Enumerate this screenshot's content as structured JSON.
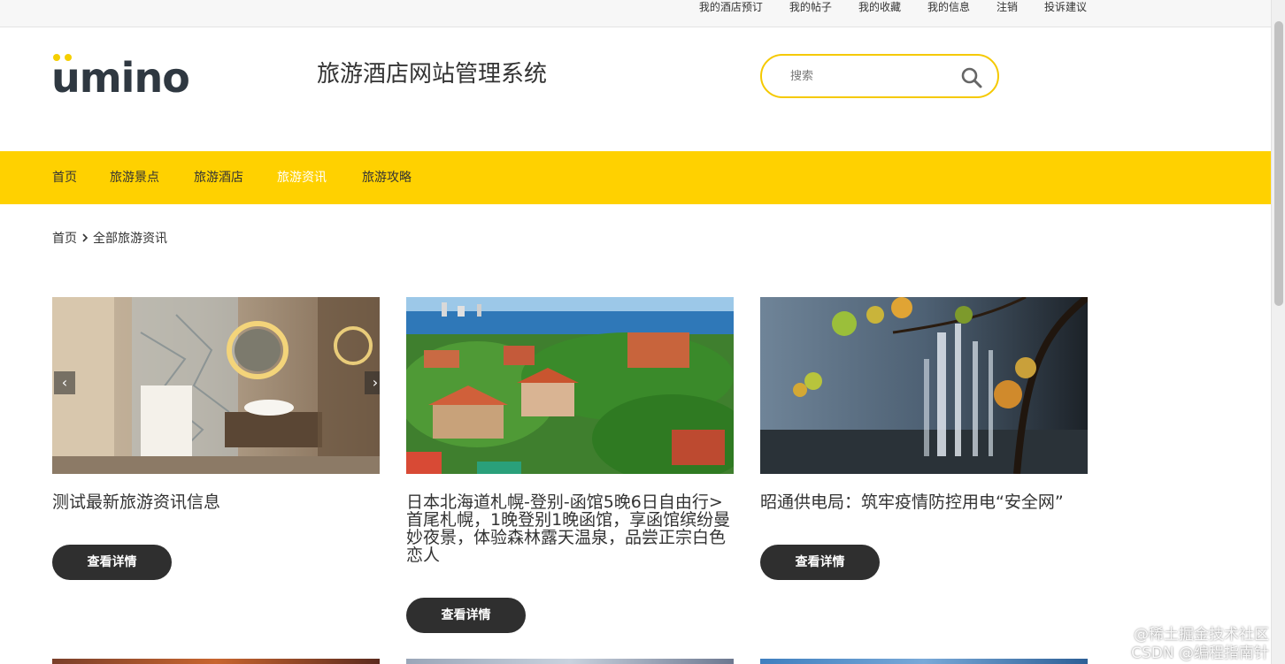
{
  "topbar": {
    "links": [
      "我的酒店预订",
      "我的帖子",
      "我的收藏",
      "我的信息",
      "注销",
      "投诉建议"
    ]
  },
  "header": {
    "logo_text": "umino",
    "site_title": "旅游酒店网站管理系统",
    "search_placeholder": "搜索",
    "accent_color": "#f5cf00"
  },
  "nav": {
    "items": [
      {
        "label": "首页",
        "active": false
      },
      {
        "label": "旅游景点",
        "active": false
      },
      {
        "label": "旅游酒店",
        "active": false
      },
      {
        "label": "旅游资讯",
        "active": true
      },
      {
        "label": "旅游攻略",
        "active": false
      }
    ],
    "background": "#ffd100"
  },
  "breadcrumb": {
    "home": "首页",
    "current": "全部旅游资讯"
  },
  "cards": [
    {
      "title": "测试最新旅游资讯信息",
      "button": "查看详情",
      "image": "hotel-bathroom-photo"
    },
    {
      "title": "日本北海道札幌-登别-函馆5晚6日自由行>首尾札幌，1晚登别1晚函馆，享函馆缤纷曼妙夜景，体验森林露天温泉，品尝正宗白色恋人",
      "button": "查看详情",
      "image": "coastal-town-aerial-photo"
    },
    {
      "title": "昭通供电局：筑牢疫情防控用电“安全网”",
      "button": "查看详情",
      "image": "waterfall-forest-photo"
    }
  ],
  "watermark": {
    "line1": "@稀土掘金技术社区",
    "line2": "CSDN @编程指南针"
  }
}
